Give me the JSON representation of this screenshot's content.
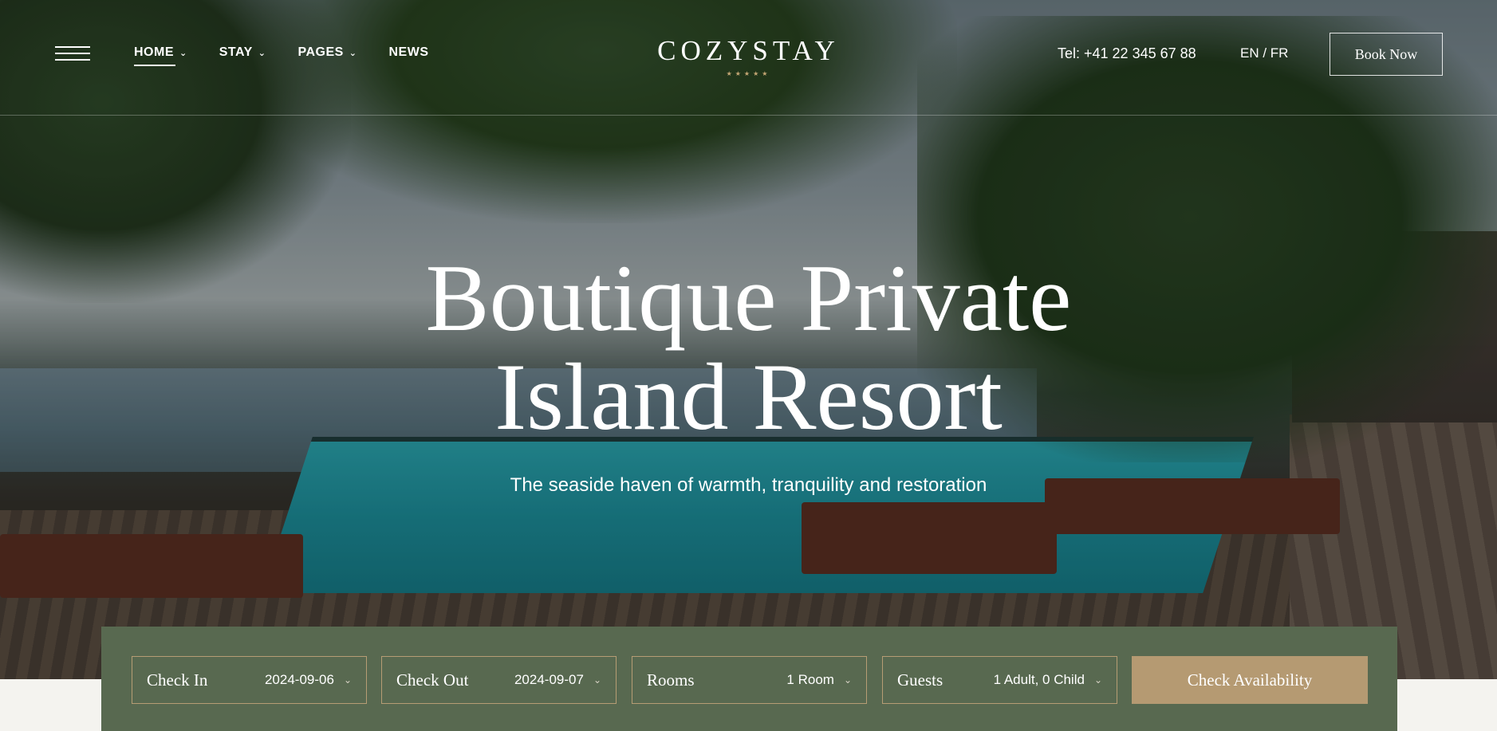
{
  "header": {
    "nav": [
      {
        "label": "HOME",
        "has_dropdown": true,
        "active": true
      },
      {
        "label": "STAY",
        "has_dropdown": true,
        "active": false
      },
      {
        "label": "PAGES",
        "has_dropdown": true,
        "active": false
      },
      {
        "label": "NEWS",
        "has_dropdown": false,
        "active": false
      }
    ],
    "logo": "COZYSTAY",
    "logo_stars": "★★★★★",
    "phone": "Tel: +41 22 345 67 88",
    "languages": "EN / FR",
    "book_now": "Book Now",
    "icons": {
      "menu": "hamburger-menu-icon",
      "dropdown": "chevron-down-icon"
    }
  },
  "hero": {
    "title_line1": "Boutique Private",
    "title_line2": "Island Resort",
    "subtitle": "The seaside haven of warmth, tranquility and restoration"
  },
  "booking": {
    "check_in": {
      "label": "Check In",
      "value": "2024-09-06"
    },
    "check_out": {
      "label": "Check Out",
      "value": "2024-09-07"
    },
    "rooms": {
      "label": "Rooms",
      "value": "1 Room"
    },
    "guests": {
      "label": "Guests",
      "value": "1 Adult, 0 Child"
    },
    "submit": "Check Availability"
  },
  "colors": {
    "booking_bar": "#586950",
    "accent_gold": "#b59a72",
    "field_border": "#b69d74"
  }
}
